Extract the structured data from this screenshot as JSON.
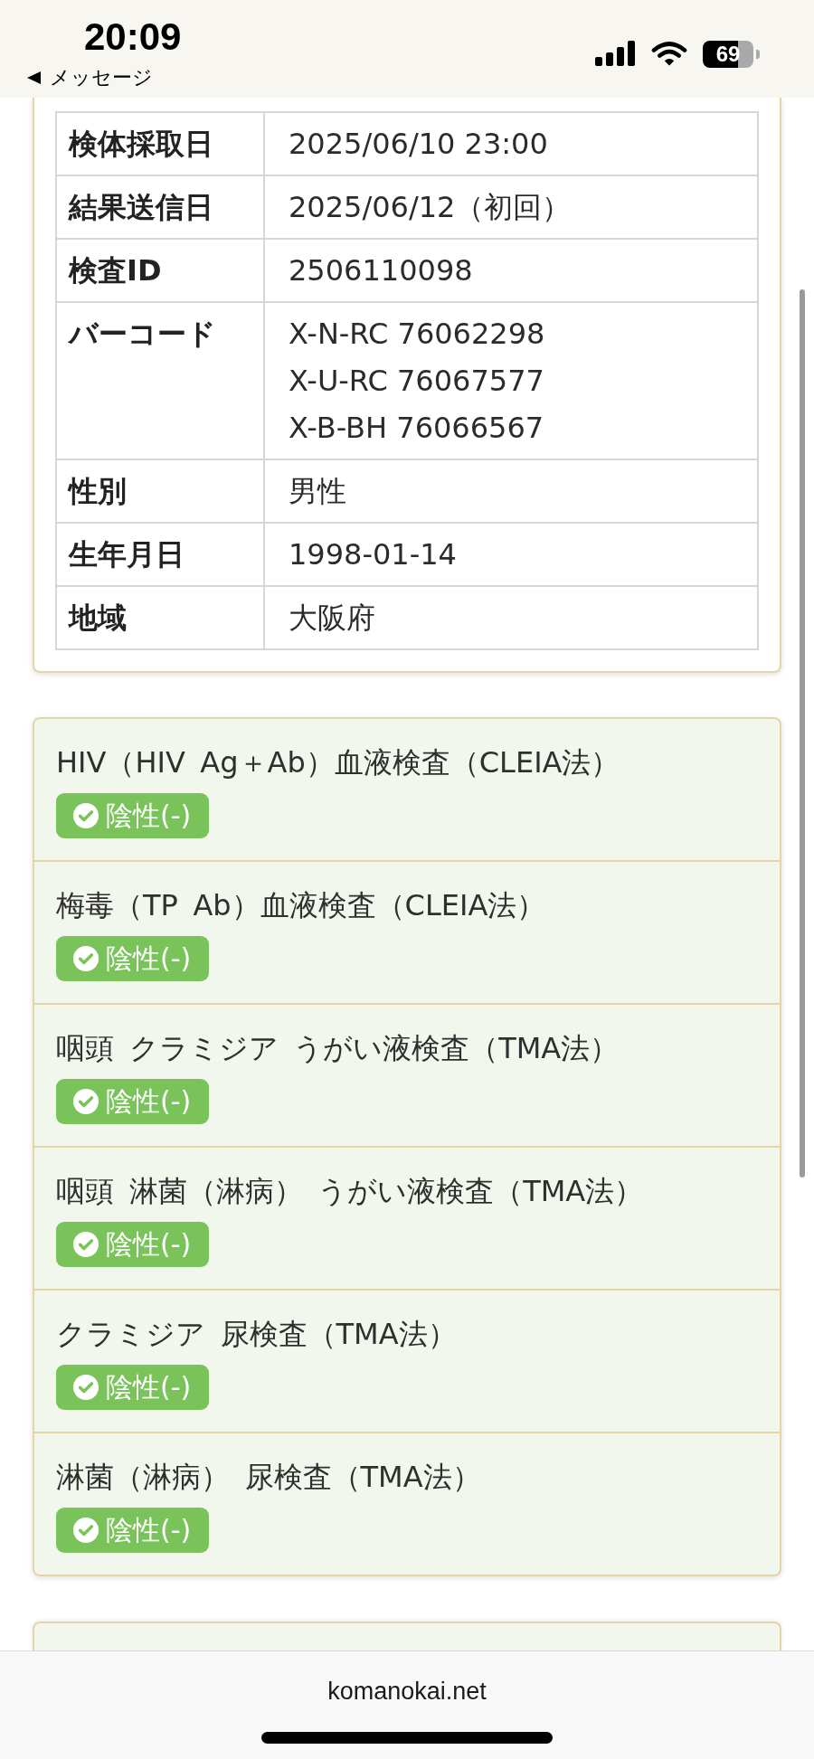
{
  "status_bar": {
    "time": "20:09",
    "back_label": "メッセージ",
    "battery": "69"
  },
  "specimen_info": {
    "rows": [
      {
        "label": "検体採取日",
        "values": [
          "2025/06/10 23:00"
        ]
      },
      {
        "label": "結果送信日",
        "values": [
          "2025/06/12（初回）"
        ]
      },
      {
        "label": "検査ID",
        "values": [
          "2506110098"
        ]
      },
      {
        "label": "バーコード",
        "values": [
          "X-N-RC 76062298",
          "X-U-RC 76067577",
          "X-B-BH 76066567"
        ]
      },
      {
        "label": "性別",
        "values": [
          "男性"
        ]
      },
      {
        "label": "生年月日",
        "values": [
          "1998-01-14"
        ]
      },
      {
        "label": "地域",
        "values": [
          "大阪府"
        ]
      }
    ]
  },
  "results": [
    {
      "test": "HIV（HIV Ag＋Ab）血液検査（CLEIA法）",
      "result": "陰性(-)",
      "kind": "negative"
    },
    {
      "test": "梅毒（TP Ab）血液検査（CLEIA法）",
      "result": "陰性(-)",
      "kind": "negative"
    },
    {
      "test": "咽頭 クラミジア うがい液検査（TMA法）",
      "result": "陰性(-)",
      "kind": "negative"
    },
    {
      "test": "咽頭 淋菌（淋病） うがい液検査（TMA法）",
      "result": "陰性(-)",
      "kind": "negative"
    },
    {
      "test": "クラミジア 尿検査（TMA法）",
      "result": "陰性(-)",
      "kind": "negative"
    },
    {
      "test": "淋菌（淋病） 尿検査（TMA法）",
      "result": "陰性(-)",
      "kind": "negative"
    }
  ],
  "browser_bar": {
    "url": "komanokai.net"
  }
}
